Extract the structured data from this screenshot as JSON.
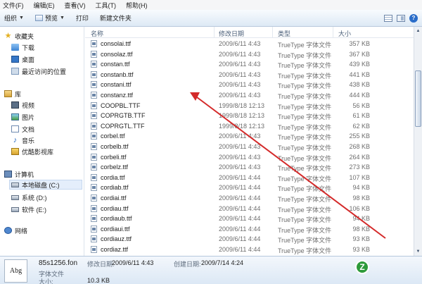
{
  "menu": [
    "文件(F)",
    "编辑(E)",
    "查看(V)",
    "工具(T)",
    "帮助(H)"
  ],
  "toolbar": {
    "organize": "组织",
    "preview": "预览",
    "print": "打印",
    "new_folder": "新建文件夹",
    "help": "?"
  },
  "nav": {
    "favorites": "收藏夹",
    "downloads": "下载",
    "desktop": "桌面",
    "recent": "最近访问的位置",
    "libraries": "库",
    "videos": "视频",
    "pictures": "图片",
    "documents": "文档",
    "music": "音乐",
    "youku": "优酷影视库",
    "computer": "计算机",
    "drive_c": "本地磁盘 (C:)",
    "drive_d": "系统 (D:)",
    "drive_e": "软件 (E:)",
    "network": "网络"
  },
  "columns": {
    "name": "名称",
    "date": "修改日期",
    "type": "类型",
    "size": "大小"
  },
  "files": [
    {
      "name": "consolai.ttf",
      "date": "2009/6/11 4:43",
      "type": "TrueType 字体文件",
      "size": "357 KB"
    },
    {
      "name": "consolaz.ttf",
      "date": "2009/6/11 4:43",
      "type": "TrueType 字体文件",
      "size": "367 KB"
    },
    {
      "name": "constan.ttf",
      "date": "2009/6/11 4:43",
      "type": "TrueType 字体文件",
      "size": "439 KB"
    },
    {
      "name": "constanb.ttf",
      "date": "2009/6/11 4:43",
      "type": "TrueType 字体文件",
      "size": "441 KB"
    },
    {
      "name": "constani.ttf",
      "date": "2009/6/11 4:43",
      "type": "TrueType 字体文件",
      "size": "438 KB"
    },
    {
      "name": "constanz.ttf",
      "date": "2009/6/11 4:43",
      "type": "TrueType 字体文件",
      "size": "444 KB"
    },
    {
      "name": "COOPBL.TTF",
      "date": "1999/8/18 12:13",
      "type": "TrueType 字体文件",
      "size": "56 KB"
    },
    {
      "name": "COPRGTB.TTF",
      "date": "1999/8/18 12:13",
      "type": "TrueType 字体文件",
      "size": "61 KB"
    },
    {
      "name": "COPRGTL.TTF",
      "date": "1999/8/18 12:13",
      "type": "TrueType 字体文件",
      "size": "62 KB"
    },
    {
      "name": "corbel.ttf",
      "date": "2009/6/11 4:43",
      "type": "TrueType 字体文件",
      "size": "255 KB"
    },
    {
      "name": "corbelb.ttf",
      "date": "2009/6/11 4:43",
      "type": "TrueType 字体文件",
      "size": "268 KB"
    },
    {
      "name": "corbeli.ttf",
      "date": "2009/6/11 4:43",
      "type": "TrueType 字体文件",
      "size": "264 KB"
    },
    {
      "name": "corbelz.ttf",
      "date": "2009/6/11 4:43",
      "type": "TrueType 字体文件",
      "size": "273 KB"
    },
    {
      "name": "cordia.ttf",
      "date": "2009/6/11 4:44",
      "type": "TrueType 字体文件",
      "size": "107 KB"
    },
    {
      "name": "cordiab.ttf",
      "date": "2009/6/11 4:44",
      "type": "TrueType 字体文件",
      "size": "94 KB"
    },
    {
      "name": "cordiai.ttf",
      "date": "2009/6/11 4:44",
      "type": "TrueType 字体文件",
      "size": "98 KB"
    },
    {
      "name": "cordiau.ttf",
      "date": "2009/6/11 4:44",
      "type": "TrueType 字体文件",
      "size": "106 KB"
    },
    {
      "name": "cordiaub.ttf",
      "date": "2009/6/11 4:44",
      "type": "TrueType 字体文件",
      "size": "94 KB"
    },
    {
      "name": "cordiaui.ttf",
      "date": "2009/6/11 4:44",
      "type": "TrueType 字体文件",
      "size": "98 KB"
    },
    {
      "name": "cordiauz.ttf",
      "date": "2009/6/11 4:44",
      "type": "TrueType 字体文件",
      "size": "93 KB"
    },
    {
      "name": "cordiaz.ttf",
      "date": "2009/6/11 4:44",
      "type": "TrueType 字体文件",
      "size": "93 KB"
    }
  ],
  "details": {
    "filename": "85s1256.fon",
    "preview_text": "Abg",
    "type": "字体文件",
    "mod_label": "修改日期:",
    "mod_value": "2009/6/11 4:43",
    "created_label": "创建日期:",
    "created_value": "2009/7/14 4:24",
    "size_label": "大小:",
    "size_value": "10.3 KB"
  },
  "logo_letter": "Z",
  "colors": {
    "arrow": "#d42a2a",
    "selection": "#e4eefb",
    "toolbar_top": "#f8fbfe",
    "toolbar_bottom": "#dde9f5"
  }
}
